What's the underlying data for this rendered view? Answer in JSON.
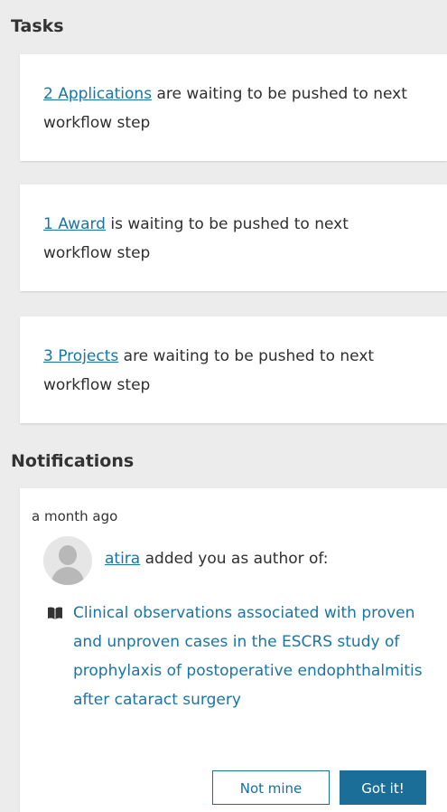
{
  "tasks": {
    "title": "Tasks",
    "items": [
      {
        "link": "2 Applications",
        "text": " are waiting to be pushed to next workflow step"
      },
      {
        "link": "1 Award",
        "text": " is waiting to be pushed to next workflow step"
      },
      {
        "link": "3 Projects",
        "text": " are waiting to be pushed to next workflow step"
      }
    ]
  },
  "notifications": {
    "title": "Notifications",
    "items": [
      {
        "time": "a month ago",
        "user": "atira",
        "action": " added you as author of:",
        "publication": "Clinical observations associated with proven and unproven cases in the ESCRS study of prophylaxis of postoperative endophthalmitis after cataract surgery",
        "publication_icon": "book-icon",
        "buttons": {
          "not_mine": "Not mine",
          "got_it": "Got it!"
        }
      }
    ]
  },
  "colors": {
    "background": "#ececec",
    "card": "#ffffff",
    "link": "#1a74a8",
    "primary_button": "#1b6e98"
  }
}
